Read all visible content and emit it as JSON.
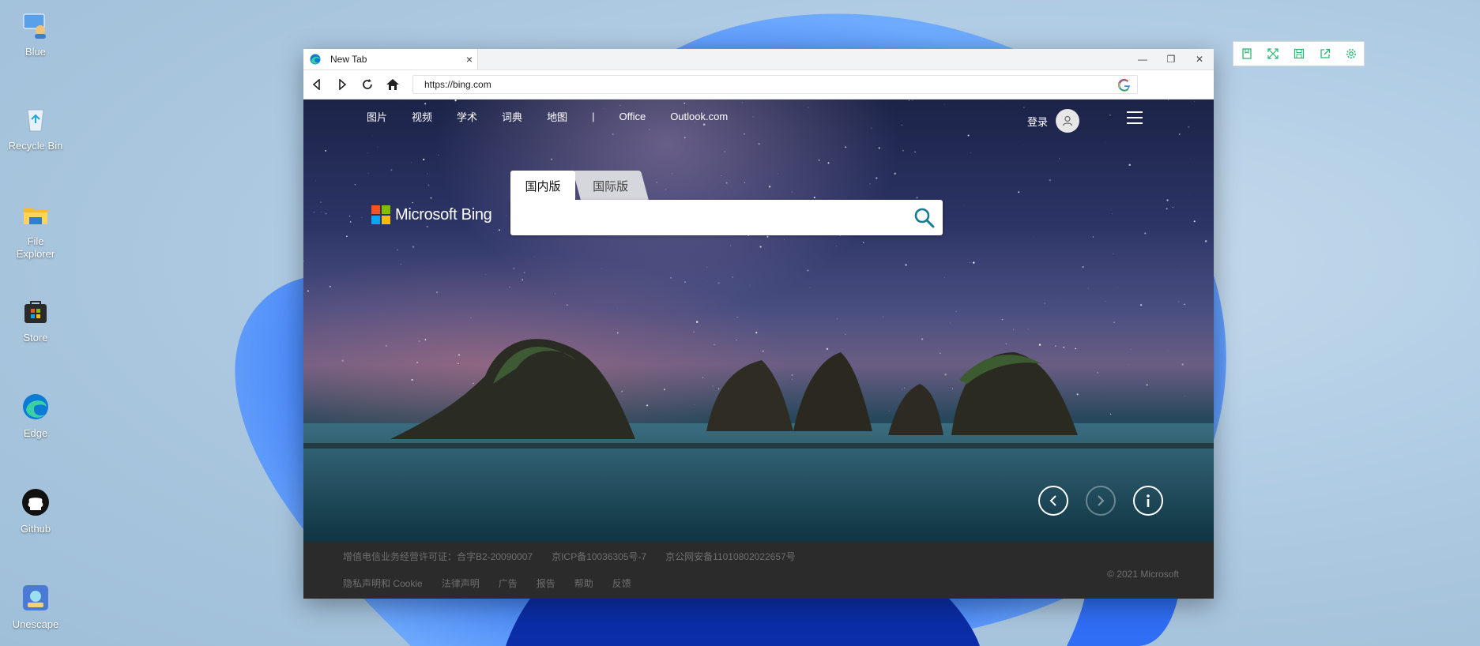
{
  "desktop": {
    "icons": [
      {
        "label": "Blue",
        "icon": "user-computer-icon"
      },
      {
        "label": "Recycle Bin",
        "icon": "recycle-bin-icon"
      },
      {
        "label": "File Explorer",
        "icon": "folder-icon"
      },
      {
        "label": "Store",
        "icon": "store-icon"
      },
      {
        "label": "Edge",
        "icon": "edge-icon"
      },
      {
        "label": "Github",
        "icon": "github-icon"
      },
      {
        "label": "Unescape",
        "icon": "unescape-icon"
      }
    ]
  },
  "browser": {
    "tab_title": "New Tab",
    "tab_close": "×",
    "window_controls": {
      "minimize": "—",
      "restore": "❐",
      "close": "✕"
    },
    "address": "https://bing.com"
  },
  "bing": {
    "nav": [
      "图片",
      "视频",
      "学术",
      "词典",
      "地图",
      "|",
      "Office",
      "Outlook.com"
    ],
    "login": "登录",
    "logo_text": "Microsoft Bing",
    "tab_domestic": "国内版",
    "tab_international": "国际版",
    "search_placeholder": "",
    "colors": {
      "ms_red": "#f35325",
      "ms_green": "#81bc06",
      "ms_blue": "#05a6f0",
      "ms_yellow": "#ffba08",
      "search_icon": "#167c91"
    }
  },
  "footer": {
    "row1": [
      "增值电信业务经营许可证：合字B2-20090007",
      "京ICP备10036305号-7",
      "京公网安备11010802022657号"
    ],
    "row2": [
      "隐私声明和 Cookie",
      "法律声明",
      "广告",
      "报告",
      "帮助",
      "反馈"
    ],
    "copyright": "© 2021 Microsoft"
  },
  "widget": {
    "icons": [
      "bookmark-icon",
      "expand-icon",
      "save-icon",
      "share-icon",
      "settings-icon"
    ],
    "accent": "#2bb673"
  }
}
